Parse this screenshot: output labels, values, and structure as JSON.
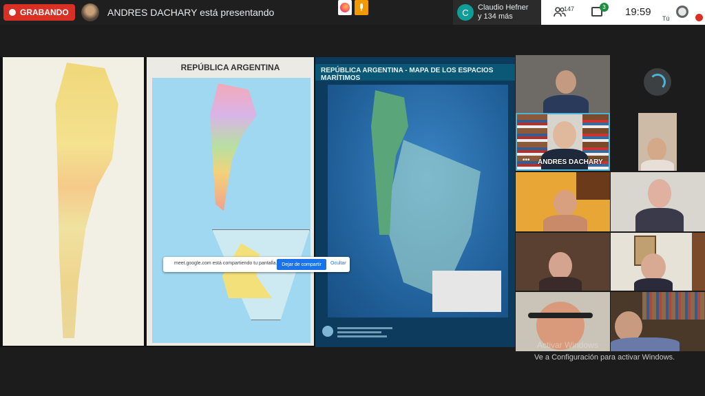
{
  "top_bar": {
    "recording_label": "GRABANDO",
    "presenter_text": "ANDRES DACHARY está presentando",
    "caller_initial": "C",
    "caller_name": "Claudio Hefner",
    "caller_more": "y 134 más",
    "people_count": "147",
    "chat_badge": "3",
    "clock": "19:59",
    "self_label": "Tú"
  },
  "presentation": {
    "map2_title": "REPÚBLICA ARGENTINA",
    "map3_title": "REPÚBLICA ARGENTINA - MAPA DE LOS ESPACIOS MARÍTIMOS"
  },
  "share_popup": {
    "message": "meet.google.com está compartiendo tu pantalla.",
    "stop_label": "Dejar de compartir",
    "hide_label": "Ocultar"
  },
  "participants": {
    "featured_name": "ANDRES DACHARY"
  },
  "windows_watermark": {
    "line1": "Activar Windows",
    "line2": "Ve a Configuración para activar Windows."
  },
  "colors": {
    "record_red": "#d93025",
    "meet_blue": "#1a73e8",
    "badge_green": "#1e8e3e"
  },
  "icons": [
    "record-dot-icon",
    "people-icon",
    "chat-icon",
    "mic-off-icon",
    "firefox-icon",
    "microphone-icon"
  ]
}
